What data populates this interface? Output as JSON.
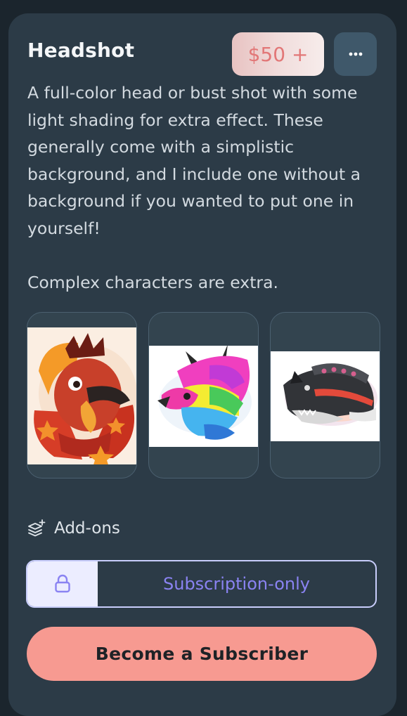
{
  "tier": {
    "title": "Headshot",
    "price": "$50 +",
    "more_icon": "more-options-icon",
    "description": "A full-color head or bust shot with some light shading for extra effect. These generally come with a simplistic background, and I include one without a background if you wanted to put one in yourself!\n\nComplex characters are extra."
  },
  "gallery": [
    {
      "subject": "red and orange bird character headshot"
    },
    {
      "subject": "rainbow triceratops headshot"
    },
    {
      "subject": "black dinosaur headshot"
    }
  ],
  "addons": {
    "icon": "layers-plus-icon",
    "label": "Add-ons"
  },
  "subscription": {
    "icon": "lock-icon",
    "label": "Subscription-only"
  },
  "cta": {
    "label": "Become a Subscriber"
  },
  "colors": {
    "page_background": "#1b252d",
    "card_background": "#2c3b47",
    "price_text": "#e27777",
    "subscription_text": "#8a83f2",
    "cta_background": "#f79a91"
  }
}
